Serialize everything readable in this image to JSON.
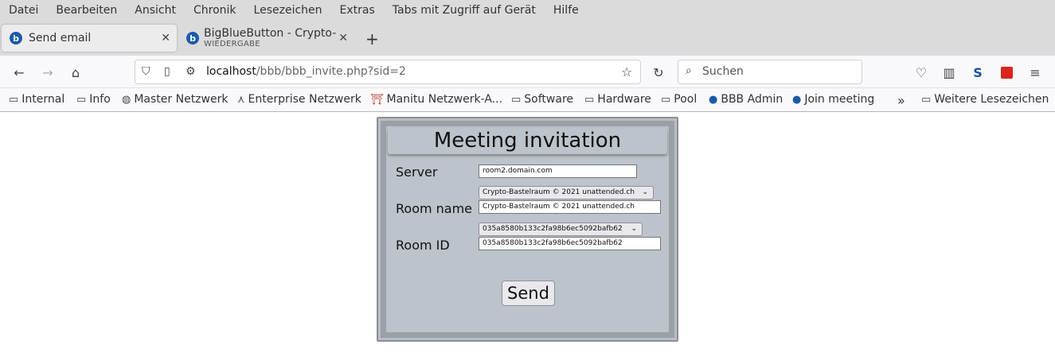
{
  "menu": [
    "Datei",
    "Bearbeiten",
    "Ansicht",
    "Chronik",
    "Lesezeichen",
    "Extras",
    "Tabs mit Zugriff auf Gerät",
    "Hilfe"
  ],
  "tabs": {
    "active": {
      "title": "Send email",
      "favicon": "bbb-icon"
    },
    "inactive": {
      "title": "BigBlueButton - Crypto-B",
      "subtitle": "WIEDERGABE",
      "favicon": "bbb-icon"
    },
    "new_tab": "+"
  },
  "nav": {
    "url_host": "localhost",
    "url_path": "/bbb/bbb_invite.php?sid=2",
    "search_placeholder": "Suchen"
  },
  "bookmarks": [
    "Internal",
    "Info",
    "Master Netzwerk",
    "Enterprise Netzwerk",
    "Manitu Netzwerk-A...",
    "Software",
    "Hardware",
    "Pool",
    "BBB Admin",
    "Join meeting"
  ],
  "bookmarks_more": "Weitere Lesezeichen",
  "form": {
    "title": "Meeting invitation",
    "server_label": "Server",
    "server_value": "room2.domain.com",
    "room_name_label": "Room name",
    "room_name_select": "Crypto-Bastelraum © 2021 unattended.ch",
    "room_name_value": "Crypto-Bastelraum © 2021 unattended.ch",
    "room_id_label": "Room ID",
    "room_id_select": "035a8580b133c2fa98b6ec5092bafb62",
    "room_id_value": "035a8580b133c2fa98b6ec5092bafb62",
    "send_label": "Send"
  }
}
